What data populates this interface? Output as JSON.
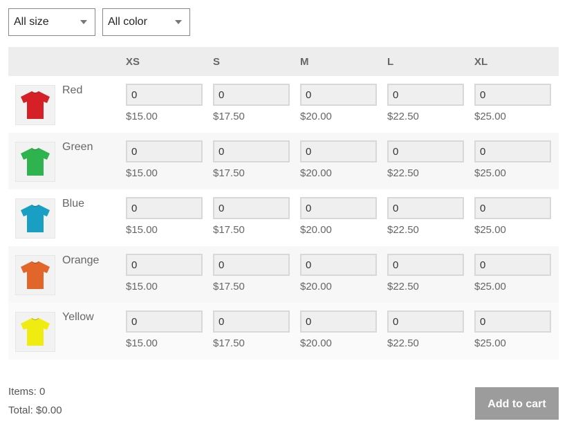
{
  "filters": {
    "size": "All size",
    "color": "All color"
  },
  "table": {
    "sizes": [
      "XS",
      "S",
      "M",
      "L",
      "XL"
    ],
    "rows": [
      {
        "color_name": "Red",
        "shirt_color": "#d42026",
        "qty": [
          "0",
          "0",
          "0",
          "0",
          "0"
        ],
        "prices": [
          "$15.00",
          "$17.50",
          "$20.00",
          "$22.50",
          "$25.00"
        ]
      },
      {
        "color_name": "Green",
        "shirt_color": "#2fb34e",
        "qty": [
          "0",
          "0",
          "0",
          "0",
          "0"
        ],
        "prices": [
          "$15.00",
          "$17.50",
          "$20.00",
          "$22.50",
          "$25.00"
        ]
      },
      {
        "color_name": "Blue",
        "shirt_color": "#1a9fc4",
        "qty": [
          "0",
          "0",
          "0",
          "0",
          "0"
        ],
        "prices": [
          "$15.00",
          "$17.50",
          "$20.00",
          "$22.50",
          "$25.00"
        ]
      },
      {
        "color_name": "Orange",
        "shirt_color": "#e2652a",
        "qty": [
          "0",
          "0",
          "0",
          "0",
          "0"
        ],
        "prices": [
          "$15.00",
          "$17.50",
          "$20.00",
          "$22.50",
          "$25.00"
        ]
      },
      {
        "color_name": "Yellow",
        "shirt_color": "#f0ec12",
        "qty": [
          "0",
          "0",
          "0",
          "0",
          "0"
        ],
        "prices": [
          "$15.00",
          "$17.50",
          "$20.00",
          "$22.50",
          "$25.00"
        ]
      }
    ]
  },
  "summary": {
    "items": "Items: 0",
    "total": "Total: $0.00"
  },
  "cart": {
    "button_label": "Add to cart",
    "button_color": "#9c9c9c"
  }
}
